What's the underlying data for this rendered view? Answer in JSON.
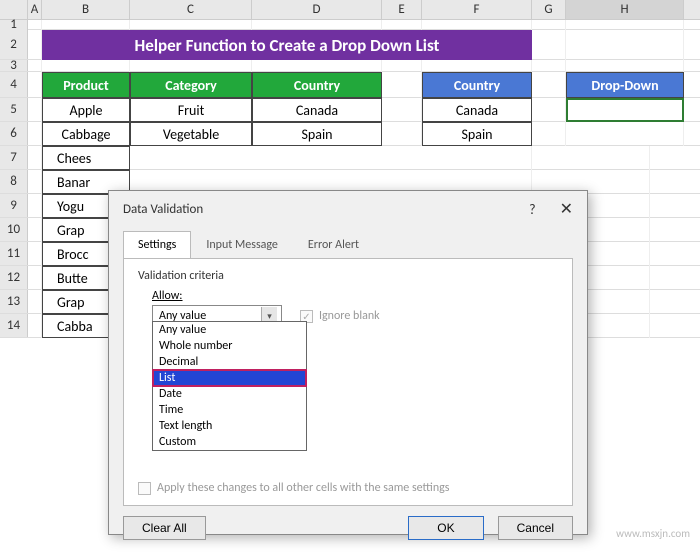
{
  "columns": [
    "A",
    "B",
    "C",
    "D",
    "E",
    "F",
    "G",
    "H"
  ],
  "rows": [
    "1",
    "2",
    "3",
    "4",
    "5",
    "6",
    "7",
    "8",
    "9",
    "10",
    "11",
    "12",
    "13",
    "14"
  ],
  "banner": "Helper Function to Create a Drop Down List",
  "headers": {
    "product": "Product",
    "category": "Category",
    "country": "Country",
    "country2": "Country",
    "dropDown": "Drop-Down"
  },
  "data": {
    "r5": {
      "b": "Apple",
      "c": "Fruit",
      "d": "Canada",
      "f": "Canada"
    },
    "r6": {
      "b": "Cabbage",
      "c": "Vegetable",
      "d": "Spain",
      "f": "Spain"
    },
    "r7": {
      "b": "Chees"
    },
    "r8": {
      "b": "Banar"
    },
    "r9": {
      "b": "Yogu"
    },
    "r10": {
      "b": "Grap"
    },
    "r11": {
      "b": "Brocc"
    },
    "r12": {
      "b": "Butte"
    },
    "r13": {
      "b": "Grap"
    },
    "r14": {
      "b": "Cabba"
    }
  },
  "dialog": {
    "title": "Data Validation",
    "tabs": {
      "settings": "Settings",
      "inputMessage": "Input Message",
      "errorAlert": "Error Alert"
    },
    "criteria": "Validation criteria",
    "allow": "Allow:",
    "allowValue": "Any value",
    "ignoreBlank": "Ignore blank",
    "options": [
      "Any value",
      "Whole number",
      "Decimal",
      "List",
      "Date",
      "Time",
      "Text length",
      "Custom"
    ],
    "applyAll": "Apply these changes to all other cells with the same settings",
    "clearAll": "Clear All",
    "ok": "OK",
    "cancel": "Cancel",
    "help": "?",
    "close": "✕"
  },
  "watermark": "www.msxjn.com"
}
